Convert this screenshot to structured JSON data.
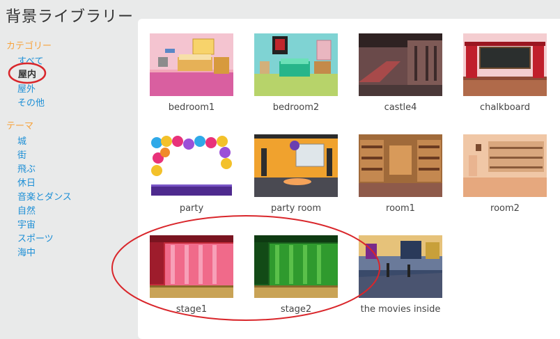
{
  "header": {
    "title": "背景ライブラリー"
  },
  "sidebar": {
    "category_heading": "カテゴリー",
    "categories": [
      "すべて",
      "屋内",
      "屋外",
      "その他"
    ],
    "selected_category": "屋内",
    "theme_heading": "テーマ",
    "themes": [
      "城",
      "街",
      "飛ぶ",
      "休日",
      "音楽とダンス",
      "自然",
      "宇宙",
      "スポーツ",
      "海中"
    ]
  },
  "backdrops": [
    {
      "label": "bedroom1"
    },
    {
      "label": "bedroom2"
    },
    {
      "label": "castle4"
    },
    {
      "label": "chalkboard"
    },
    {
      "label": "party"
    },
    {
      "label": "party room"
    },
    {
      "label": "room1"
    },
    {
      "label": "room2"
    },
    {
      "label": "stage1"
    },
    {
      "label": "stage2"
    },
    {
      "label": "the movies inside"
    }
  ],
  "colors": {
    "category_heading": "#f7a23b",
    "link": "#1d8fd6",
    "annotation_circle": "#d9262b"
  }
}
